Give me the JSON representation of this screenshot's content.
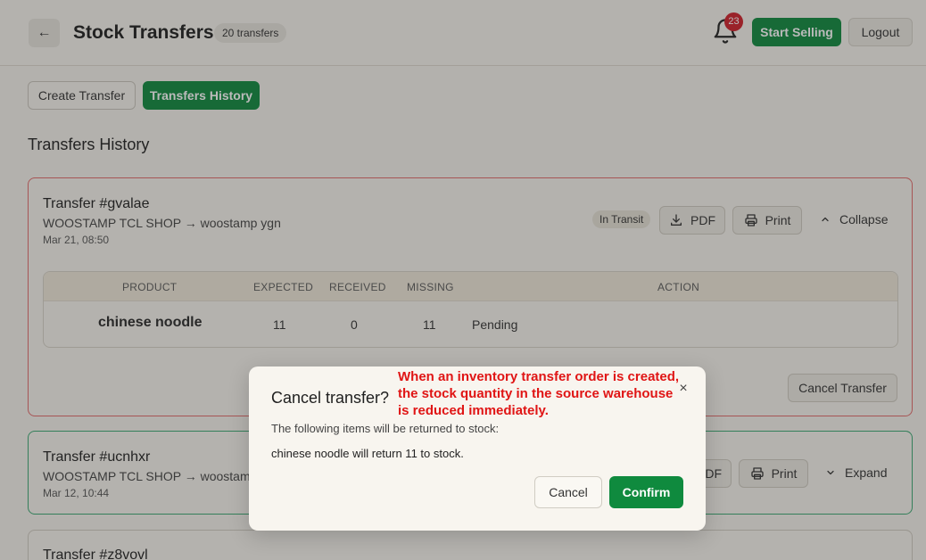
{
  "header": {
    "back_label": "←",
    "title": "Stock Transfers",
    "count_badge": "20 transfers",
    "notification_count": "23",
    "start_selling": "Start Selling",
    "logout": "Logout"
  },
  "tabs": {
    "create": "Create Transfer",
    "history": "Transfers History"
  },
  "section_title": "Transfers History",
  "transfers": [
    {
      "title": "Transfer #gvalae",
      "route": "WOOSTAMP TCL SHOP → woostamp ygn",
      "date": "Mar 21, 08:50",
      "status": "In Transit",
      "pdf": "PDF",
      "print": "Print",
      "toggle": "Collapse",
      "table": {
        "headers": [
          "PRODUCT",
          "EXPECTED",
          "RECEIVED",
          "MISSING",
          "ACTION"
        ],
        "rows": [
          {
            "product": "chinese noodle",
            "expected": "11",
            "received": "0",
            "missing": "11",
            "action": "Pending"
          }
        ]
      },
      "cancel_button": "Cancel Transfer"
    },
    {
      "title": "Transfer #ucnhxr",
      "route": "WOOSTAMP TCL SHOP → woostamp",
      "date": "Mar 12, 10:44",
      "pdf": "PDF",
      "print": "Print",
      "toggle": "Expand"
    },
    {
      "title": "Transfer #z8vovl"
    }
  ],
  "modal": {
    "title": "Cancel transfer?",
    "close": "×",
    "description": "The following items will be returned to stock:",
    "item_text": "chinese noodle will return 11 to stock.",
    "cancel": "Cancel",
    "confirm": "Confirm"
  },
  "annotation": "When an inventory transfer order is created, the stock quantity in the source warehouse is reduced immediately.",
  "colors": {
    "primary_green": "#0f8a3e",
    "alert_red": "#d0202a",
    "annotation_red": "#e01515",
    "active_card_border": "#e36a6a",
    "card_border_green": "#3aa872"
  }
}
